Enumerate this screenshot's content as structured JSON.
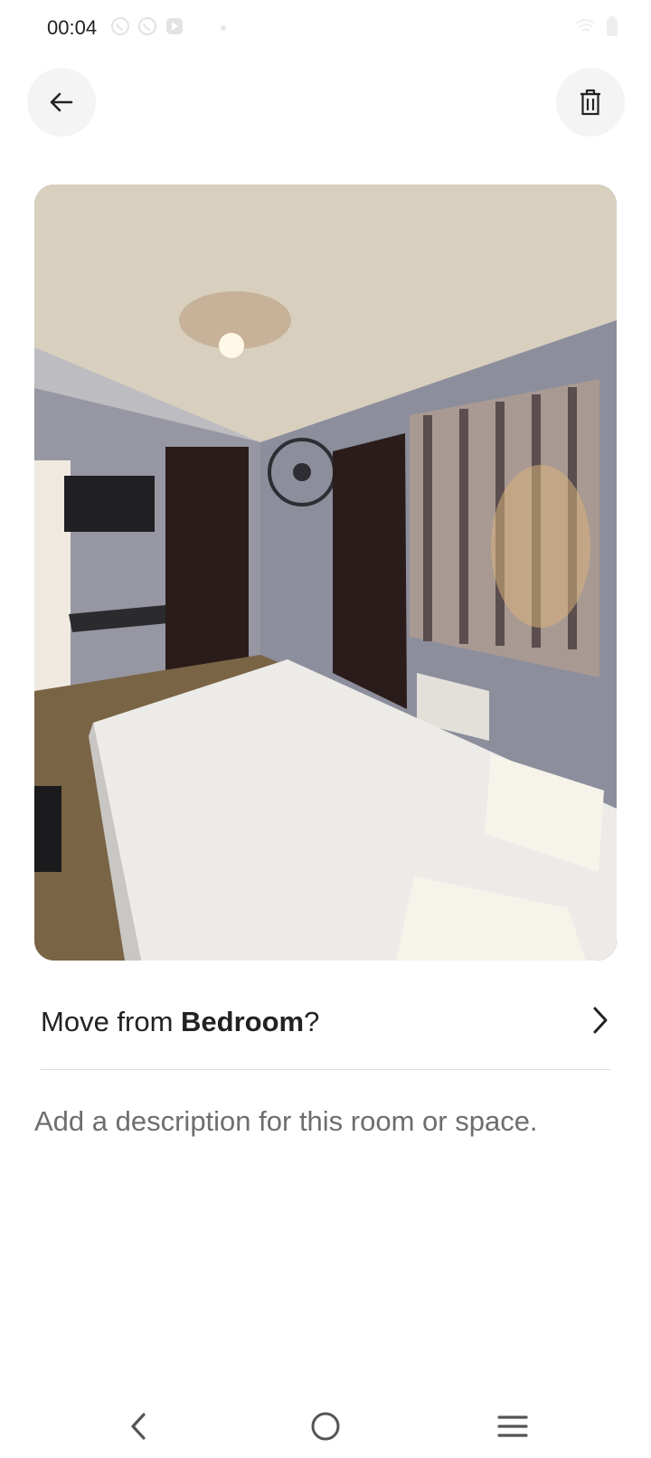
{
  "status_bar": {
    "time": "00:04",
    "left_icons": [
      "whatsapp-icon",
      "whatsapp-icon",
      "app-notification-icon"
    ],
    "right_icons": [
      "wifi-icon",
      "battery-icon"
    ]
  },
  "header": {
    "back_icon": "arrow-left-icon",
    "delete_icon": "trash-icon"
  },
  "photo": {
    "subject": "bedroom photo"
  },
  "move_row": {
    "prefix": "Move from ",
    "room": "Bedroom",
    "suffix": "?"
  },
  "description": {
    "placeholder": "Add a description for this room or space."
  },
  "nav_bar": {
    "items": [
      "back-nav-icon",
      "home-nav-icon",
      "recents-nav-icon"
    ]
  },
  "colors": {
    "text": "#222222",
    "muted_text": "#6e6e6e",
    "button_bg": "#f4f4f4",
    "divider": "#dcdcdc"
  }
}
